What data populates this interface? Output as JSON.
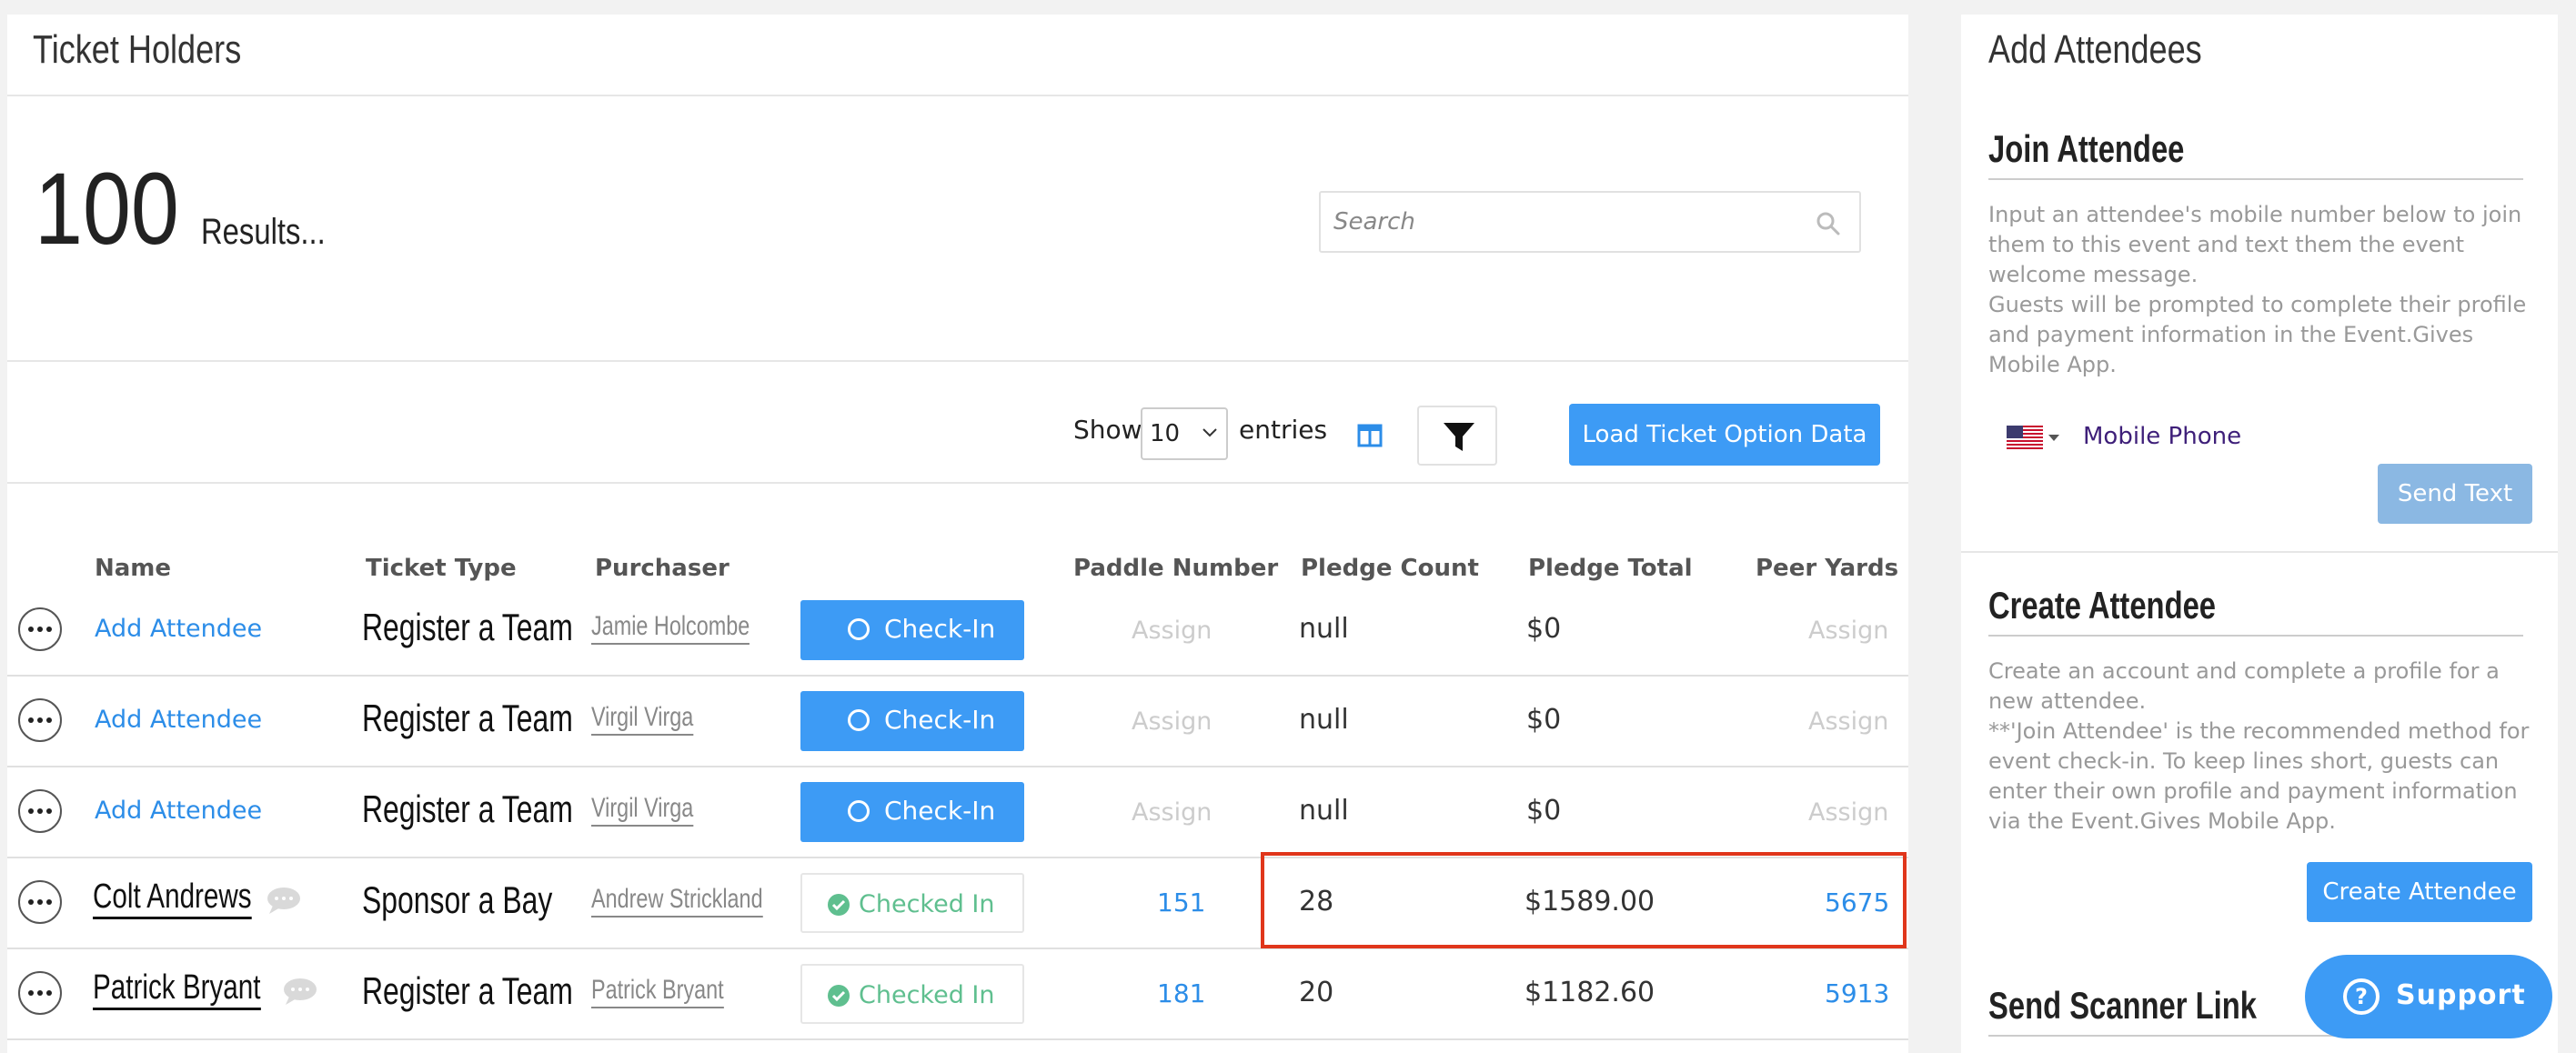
{
  "left_panel": {
    "title": "Ticket Holders",
    "results_count": "100",
    "results_label": "Results...",
    "search": {
      "placeholder": "Search"
    },
    "toolbar": {
      "show_label": "Show",
      "entries_value": "10",
      "entries_label": "entries",
      "load_button": "Load Ticket Option Data"
    },
    "table": {
      "headers": {
        "name": "Name",
        "ticket_type": "Ticket Type",
        "purchaser": "Purchaser",
        "paddle_number": "Paddle Number",
        "pledge_count": "Pledge Count",
        "pledge_total": "Pledge Total",
        "peer_yards": "Peer Yards"
      },
      "rows": [
        {
          "name": "Add Attendee",
          "ticket_type": "Register a Team",
          "purchaser": "Jamie Holcombe",
          "checkin": "Check-In",
          "paddle": "Assign",
          "pledge_count": "null",
          "pledge_total": "$0",
          "peer_yards": "Assign"
        },
        {
          "name": "Add Attendee",
          "ticket_type": "Register a Team",
          "purchaser": "Virgil Virga",
          "checkin": "Check-In",
          "paddle": "Assign",
          "pledge_count": "null",
          "pledge_total": "$0",
          "peer_yards": "Assign"
        },
        {
          "name": "Add Attendee",
          "ticket_type": "Register a Team",
          "purchaser": "Virgil Virga",
          "checkin": "Check-In",
          "paddle": "Assign",
          "pledge_count": "null",
          "pledge_total": "$0",
          "peer_yards": "Assign"
        },
        {
          "name": "Colt Andrews",
          "ticket_type": "Sponsor a Bay",
          "purchaser": "Andrew Strickland",
          "checkin": "Checked In",
          "paddle": "151",
          "pledge_count": "28",
          "pledge_total": "$1589.00",
          "peer_yards": "5675"
        },
        {
          "name": "Patrick Bryant",
          "ticket_type": "Register a Team",
          "purchaser": "Patrick Bryant",
          "checkin": "Checked In",
          "paddle": "181",
          "pledge_count": "20",
          "pledge_total": "$1182.60",
          "peer_yards": "5913"
        }
      ]
    }
  },
  "right_panel": {
    "title": "Add Attendees",
    "join": {
      "title": "Join Attendee",
      "text1": "Input an attendee's mobile number below to join them to this event and text them the event welcome message.",
      "text2": "Guests will be prompted to complete their profile and payment information in the Event.Gives Mobile App.",
      "phone_placeholder": "Mobile Phone",
      "send_button": "Send Text"
    },
    "create": {
      "title": "Create Attendee",
      "text1": "Create an account and complete a profile for a new attendee.",
      "text2": "**'Join Attendee' is the recommended method for event check-in. To keep lines short, guests can enter their own profile and payment information via the Event.Gives Mobile App.",
      "button": "Create Attendee"
    },
    "scanner": {
      "title": "Send Scanner Link"
    }
  },
  "support": {
    "label": "Support"
  },
  "colors": {
    "primary": "#3d9bf5",
    "link": "#2c8de8",
    "checked_green": "#5fbf8f",
    "highlight": "#e0361b"
  }
}
